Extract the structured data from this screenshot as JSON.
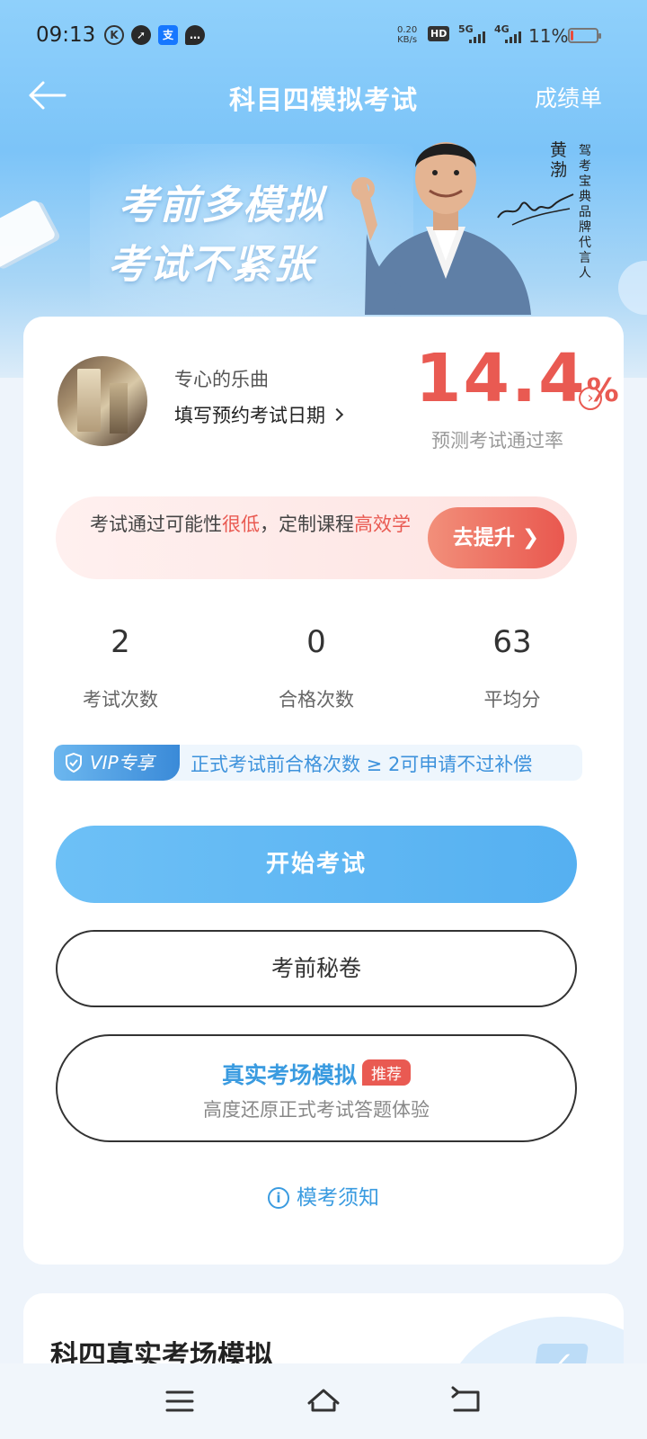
{
  "status_bar": {
    "time": "09:13",
    "net_speed_value": "0.20",
    "net_speed_unit": "KB/s",
    "hd_label": "HD",
    "sim1_label": "5G",
    "sim2_label": "4G",
    "battery_pct": "11%",
    "battery_level": 0.11,
    "alipay_glyph": "支"
  },
  "header": {
    "title": "科目四模拟考试",
    "back_icon": "back-arrow-icon",
    "right_link": "成绩单"
  },
  "banner": {
    "slogan_line1": "考前多模拟",
    "slogan_line2": "考试不紧张",
    "endorser_name": "黄渤",
    "endorser_role": "驾考宝典品牌代言人"
  },
  "profile": {
    "username": "专心的乐曲",
    "exam_date_link": "填写预约考试日期",
    "pass_rate": "14.4",
    "pass_rate_unit": "%",
    "pass_rate_label": "预测考试通过率"
  },
  "tip": {
    "part1": "考试通过可能性",
    "highlight1": "很低",
    "part2": "，定制课程",
    "highlight2": "高效学",
    "button": "去提升"
  },
  "stats": [
    {
      "value": "2",
      "label": "考试次数"
    },
    {
      "value": "0",
      "label": "合格次数"
    },
    {
      "value": "63",
      "label": "平均分"
    }
  ],
  "vip": {
    "tag": "VIP专享",
    "text": "正式考试前合格次数 ≥ 2可申请不过补偿"
  },
  "actions": {
    "start_exam": "开始考试",
    "secret_paper": "考前秘卷",
    "real_sim_title": "真实考场模拟",
    "real_sim_badge": "推荐",
    "real_sim_sub": "高度还原正式考试答题体验",
    "notice": "模考须知"
  },
  "section2": {
    "title": "科四真实考场模拟"
  },
  "colors": {
    "accent_blue": "#55b0f1",
    "accent_red": "#e95a52"
  }
}
